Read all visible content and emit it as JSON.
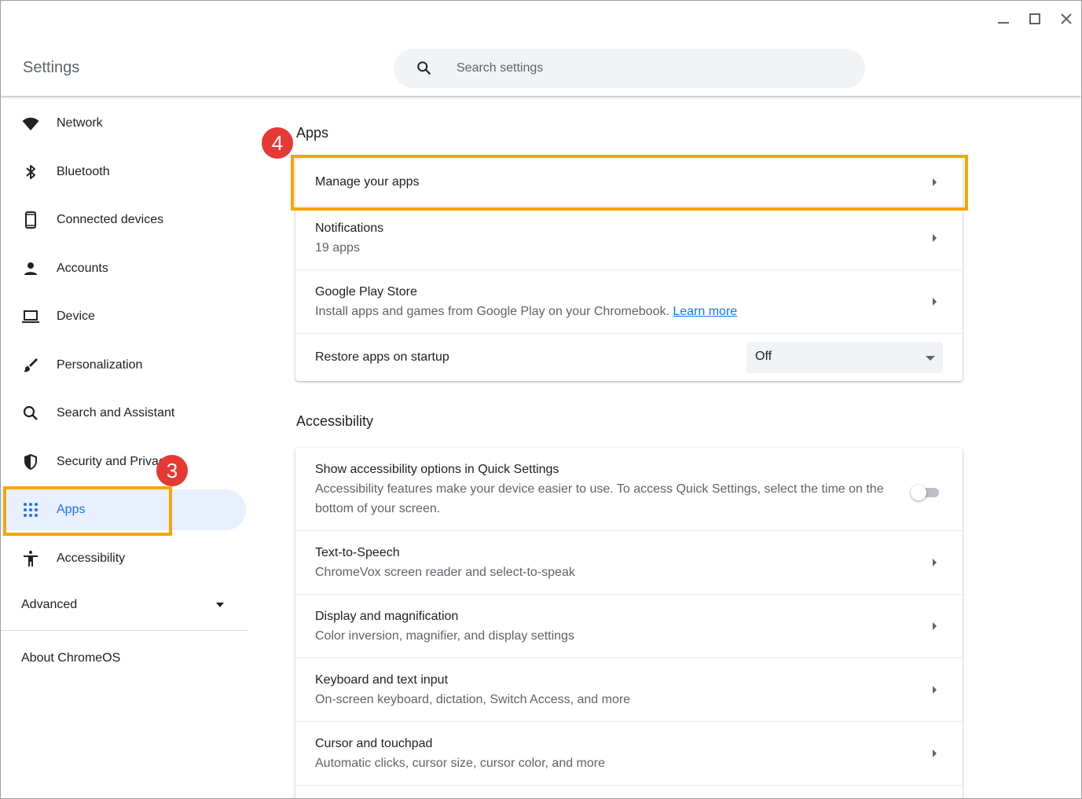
{
  "header": {
    "title": "Settings",
    "search_placeholder": "Search settings",
    "window_controls": [
      "minimize-icon",
      "maximize-icon",
      "close-icon"
    ]
  },
  "sidebar": {
    "items": [
      {
        "label": "Network",
        "icon": "wifi-icon"
      },
      {
        "label": "Bluetooth",
        "icon": "bluetooth-icon"
      },
      {
        "label": "Connected devices",
        "icon": "phone-icon"
      },
      {
        "label": "Accounts",
        "icon": "person-icon"
      },
      {
        "label": "Device",
        "icon": "laptop-icon"
      },
      {
        "label": "Personalization",
        "icon": "brush-icon"
      },
      {
        "label": "Search and Assistant",
        "icon": "search-icon"
      },
      {
        "label": "Security and Privacy",
        "icon": "shield-icon"
      },
      {
        "label": "Apps",
        "icon": "apps-grid-icon",
        "active": true
      },
      {
        "label": "Accessibility",
        "icon": "accessibility-icon"
      }
    ],
    "advanced_label": "Advanced",
    "about_label": "About ChromeOS"
  },
  "apps_section": {
    "title": "Apps",
    "rows": [
      {
        "title": "Manage your apps"
      },
      {
        "title": "Notifications",
        "subtitle": "19 apps"
      },
      {
        "title": "Google Play Store",
        "subtitle": "Install apps and games from Google Play on your Chromebook.",
        "link": "Learn more"
      },
      {
        "title": "Restore apps on startup",
        "select_value": "Off"
      }
    ]
  },
  "accessibility_section": {
    "title": "Accessibility",
    "rows": [
      {
        "title": "Show accessibility options in Quick Settings",
        "subtitle": "Accessibility features make your device easier to use. To access Quick Settings, select the time on the bottom of your screen.",
        "toggle_on": false
      },
      {
        "title": "Text-to-Speech",
        "subtitle": "ChromeVox screen reader and select-to-speak"
      },
      {
        "title": "Display and magnification",
        "subtitle": "Color inversion, magnifier, and display settings"
      },
      {
        "title": "Keyboard and text input",
        "subtitle": "On-screen keyboard, dictation, Switch Access, and more"
      },
      {
        "title": "Cursor and touchpad",
        "subtitle": "Automatic clicks, cursor size, cursor color, and more"
      }
    ]
  },
  "annotations": {
    "step_sidebar": "3",
    "step_manage": "4",
    "highlight_color": "#f5a600",
    "badge_color": "#e53935"
  },
  "colors": {
    "accent": "#1a73e8",
    "active_bg": "#e8f0fe"
  }
}
